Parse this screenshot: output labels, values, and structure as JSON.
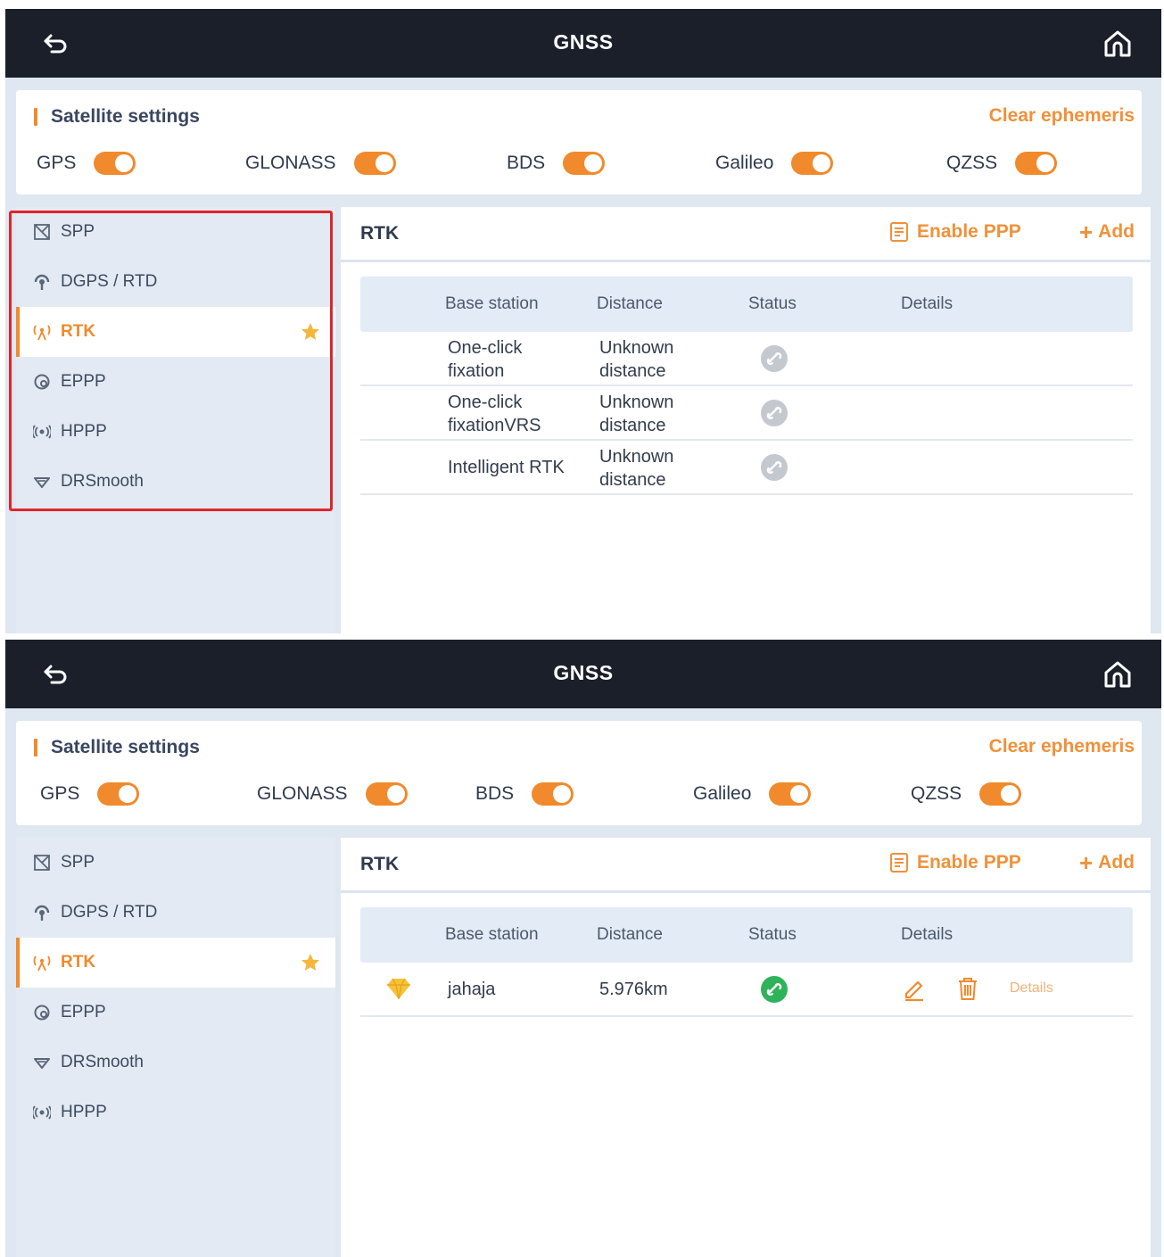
{
  "screens": [
    {
      "topbar": {
        "title": "GNSS",
        "back_icon": "back-arrow-icon",
        "home_icon": "home-icon"
      },
      "satellite": {
        "title": "Satellite settings",
        "clear_label": "Clear ephemeris",
        "systems": [
          {
            "label": "GPS",
            "enabled": true
          },
          {
            "label": "GLONASS",
            "enabled": true
          },
          {
            "label": "BDS",
            "enabled": true
          },
          {
            "label": "Galileo",
            "enabled": true
          },
          {
            "label": "QZSS",
            "enabled": true
          }
        ]
      },
      "sidebar": {
        "items": [
          {
            "label": "SPP",
            "icon": "satellite-icon"
          },
          {
            "label": "DGPS / RTD",
            "icon": "antenna-icon"
          },
          {
            "label": "RTK",
            "icon": "radio-tower-icon",
            "active": true
          },
          {
            "label": "EPPP",
            "icon": "globe-icon"
          },
          {
            "label": "HPPP",
            "icon": "signal-icon"
          },
          {
            "label": "DRSmooth",
            "icon": "smooth-icon"
          }
        ]
      },
      "panel": {
        "title": "RTK",
        "enable_ppp": "Enable PPP",
        "add_label": "Add",
        "columns": [
          "Base station",
          "Distance",
          "Status",
          "Details"
        ],
        "rows": [
          {
            "base": "One-click fixation",
            "distance": "Unknown distance",
            "status": "disconnected"
          },
          {
            "base": "One-click fixationVRS",
            "distance": "Unknown distance",
            "status": "disconnected"
          },
          {
            "base": "Intelligent RTK",
            "distance": "Unknown distance",
            "status": "disconnected"
          }
        ]
      }
    },
    {
      "topbar": {
        "title": "GNSS",
        "back_icon": "back-arrow-icon",
        "home_icon": "home-icon"
      },
      "satellite": {
        "title": "Satellite settings",
        "clear_label": "Clear ephemeris",
        "systems": [
          {
            "label": "GPS",
            "enabled": true
          },
          {
            "label": "GLONASS",
            "enabled": true
          },
          {
            "label": "BDS",
            "enabled": true
          },
          {
            "label": "Galileo",
            "enabled": true
          },
          {
            "label": "QZSS",
            "enabled": true
          }
        ]
      },
      "sidebar": {
        "items": [
          {
            "label": "SPP",
            "icon": "satellite-icon"
          },
          {
            "label": "DGPS / RTD",
            "icon": "antenna-icon"
          },
          {
            "label": "RTK",
            "icon": "radio-tower-icon",
            "active": true
          },
          {
            "label": "EPPP",
            "icon": "globe-icon"
          },
          {
            "label": "DRSmooth",
            "icon": "smooth-icon"
          },
          {
            "label": "HPPP",
            "icon": "signal-icon"
          }
        ]
      },
      "panel": {
        "title": "RTK",
        "enable_ppp": "Enable PPP",
        "add_label": "Add",
        "columns": [
          "Base station",
          "Distance",
          "Status",
          "Details"
        ],
        "rows": [
          {
            "base": "jahaja",
            "distance": "5.976km",
            "status": "connected",
            "details_label": "Details",
            "marker_icon": "diamond-icon"
          }
        ]
      }
    }
  ],
  "colors": {
    "accent": "#f08a2c",
    "topbar": "#1a1f2a",
    "highlight_box": "#e0242a",
    "connected": "#2fb35a",
    "disconnected": "#c4c8cf"
  }
}
